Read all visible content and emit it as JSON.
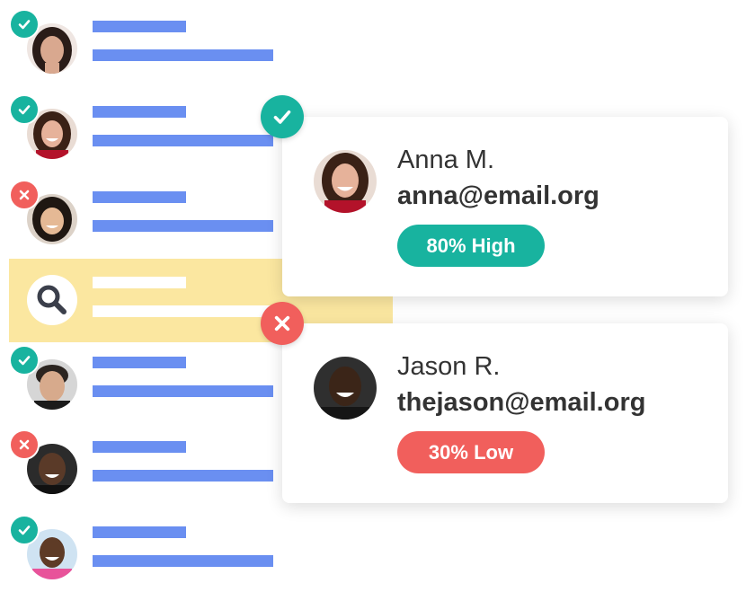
{
  "colors": {
    "bar": "#6a8ff1",
    "approve": "#18b39f",
    "reject": "#f15f5c",
    "highlight": "#fbe7a0",
    "text": "#333333"
  },
  "list": [
    {
      "status": "approved",
      "status_icon": "check-icon"
    },
    {
      "status": "approved",
      "status_icon": "check-icon"
    },
    {
      "status": "rejected",
      "status_icon": "close-icon"
    },
    {
      "status": "approved",
      "status_icon": "check-icon"
    },
    {
      "status": "rejected",
      "status_icon": "close-icon"
    },
    {
      "status": "approved",
      "status_icon": "check-icon"
    }
  ],
  "search_row": {
    "icon": "search-icon"
  },
  "cards": [
    {
      "name": "Anna M.",
      "email": "anna@email.org",
      "score_label": "80% High",
      "score": 80,
      "status": "approved",
      "status_icon": "check-icon"
    },
    {
      "name": "Jason R.",
      "email": "thejason@email.org",
      "score_label": "30% Low",
      "score": 30,
      "status": "rejected",
      "status_icon": "close-icon"
    }
  ]
}
